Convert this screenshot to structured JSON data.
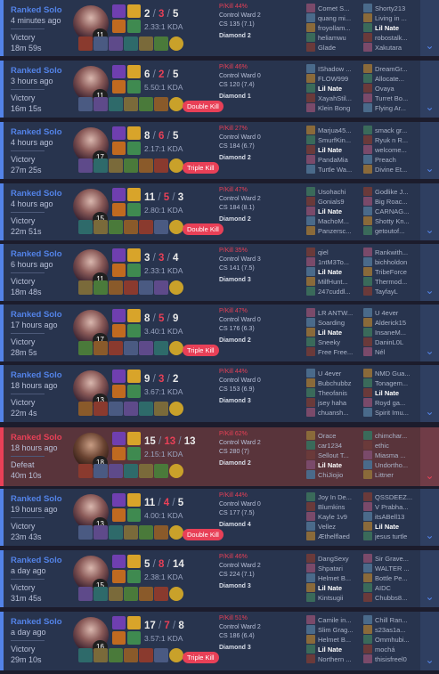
{
  "colors": {
    "victory_accent": "#5383e8",
    "defeat_accent": "#e84057",
    "victory_bg": "#28344e",
    "defeat_bg": "#59343b"
  },
  "icons": {
    "expand": "chevron-down-icon"
  },
  "matches": [
    {
      "type": "Ranked Solo",
      "ago": "4 minutes ago",
      "result": "Victory",
      "duration": "18m 59s",
      "win": true,
      "level": "11",
      "k": "2",
      "d": "3",
      "a": "5",
      "kda": "2.33:1 KDA",
      "multikill": "",
      "kp": "P/Kill 44%",
      "ward": "Control Ward 2",
      "cs": "CS 135 (7.1)",
      "rank": "Diamond 2",
      "blue": [
        "Comet S...",
        "quang mi...",
        "froyollam...",
        "heliamwu",
        "Glade"
      ],
      "red": [
        "Shorty213",
        "Living in ...",
        "Lil Nate",
        "robostalk...",
        "Xakutara"
      ]
    },
    {
      "type": "Ranked Solo",
      "ago": "3 hours ago",
      "result": "Victory",
      "duration": "16m 15s",
      "win": true,
      "level": "11",
      "k": "6",
      "d": "2",
      "a": "5",
      "kda": "5.50:1 KDA",
      "multikill": "Double Kill",
      "kp": "P/Kill 46%",
      "ward": "Control Ward 0",
      "cs": "CS 120 (7.4)",
      "rank": "Diamond 1",
      "blue": [
        "IShadow ...",
        "FLOW999",
        "Lil Nate",
        "XayahStil...",
        "Klein Bong"
      ],
      "red": [
        "DreamGr...",
        "Allocate...",
        "Ovaya",
        "Turret Bo...",
        "Flying Ar..."
      ]
    },
    {
      "type": "Ranked Solo",
      "ago": "4 hours ago",
      "result": "Victory",
      "duration": "27m 25s",
      "win": true,
      "level": "17",
      "k": "8",
      "d": "6",
      "a": "5",
      "kda": "2.17:1 KDA",
      "multikill": "Triple Kill",
      "kp": "P/Kill 27%",
      "ward": "Control Ward 0",
      "cs": "CS 184 (6.7)",
      "rank": "Diamond 2",
      "blue": [
        "Marjua45...",
        "SmurfKin...",
        "Lil Nate",
        "PandaMia",
        "Turtle Wa..."
      ],
      "red": [
        "smack gr...",
        "Ryuk n R...",
        "welcome...",
        "Preach",
        "Divine Et..."
      ]
    },
    {
      "type": "Ranked Solo",
      "ago": "4 hours ago",
      "result": "Victory",
      "duration": "22m 51s",
      "win": true,
      "level": "15",
      "k": "11",
      "d": "5",
      "a": "3",
      "kda": "2.80:1 KDA",
      "multikill": "Double Kill",
      "kp": "P/Kill 47%",
      "ward": "Control Ward 2",
      "cs": "CS 184 (8.1)",
      "rank": "Diamond 2",
      "blue": [
        "Usohachi",
        "Gonials9",
        "Lil Nate",
        "MachoM...",
        "Panzersc..."
      ],
      "red": [
        "Godlike J...",
        "Big Roac...",
        "CARNAG...",
        "Shotty Kn...",
        "getoutof..."
      ]
    },
    {
      "type": "Ranked Solo",
      "ago": "6 hours ago",
      "result": "Victory",
      "duration": "18m 48s",
      "win": true,
      "level": "11",
      "k": "3",
      "d": "3",
      "a": "4",
      "kda": "2.33:1 KDA",
      "multikill": "",
      "kp": "P/Kill 35%",
      "ward": "Control Ward 3",
      "cs": "CS 141 (7.5)",
      "rank": "Diamond 3",
      "blue": [
        "qiel",
        "1ntM3To...",
        "Lil Nate",
        "MilfHunt...",
        "247cuddl..."
      ],
      "red": [
        "Rankwith...",
        "bichholdon",
        "TribeForce",
        "Thermod...",
        "TayfayL"
      ]
    },
    {
      "type": "Ranked Solo",
      "ago": "17 hours ago",
      "result": "Victory",
      "duration": "28m 5s",
      "win": true,
      "level": "17",
      "k": "8",
      "d": "5",
      "a": "9",
      "kda": "3.40:1 KDA",
      "multikill": "Triple Kill",
      "kp": "P/Kill 47%",
      "ward": "Control Ward 0",
      "cs": "CS 176 (6.3)",
      "rank": "Diamond 2",
      "blue": [
        "LR ANTW...",
        "Soarding",
        "Lil Nate",
        "Sneeky",
        "Free Free..."
      ],
      "red": [
        "U 4ever",
        "Alderick15",
        "InsaneM...",
        "DaninL0L",
        "Nél"
      ]
    },
    {
      "type": "Ranked Solo",
      "ago": "18 hours ago",
      "result": "Victory",
      "duration": "22m 4s",
      "win": true,
      "level": "13",
      "k": "9",
      "d": "3",
      "a": "2",
      "kda": "3.67:1 KDA",
      "multikill": "",
      "kp": "P/Kill 44%",
      "ward": "Control Ward 0",
      "cs": "CS 153 (6.9)",
      "rank": "Diamond 3",
      "blue": [
        "U 4ever",
        "Bubchubbz",
        "Theofanis",
        "jsey haha",
        "chuansh..."
      ],
      "red": [
        "NMD Gua...",
        "Tonagem...",
        "Lil Nate",
        "Royd ga...",
        "Spirit Imu..."
      ]
    },
    {
      "type": "Ranked Solo",
      "ago": "18 hours ago",
      "result": "Defeat",
      "duration": "40m 10s",
      "win": false,
      "level": "18",
      "k": "15",
      "d": "13",
      "a": "13",
      "kda": "2.15:1 KDA",
      "multikill": "",
      "kp": "P/Kill 62%",
      "ward": "Control Ward 2",
      "cs": "CS 280 (7)",
      "rank": "Diamond 2",
      "blue": [
        "Orace",
        "car1234",
        "Sellout T...",
        "Lil Nate",
        "ChiJiojio"
      ],
      "red": [
        "chimchar...",
        "ethic",
        "Miasma ...",
        "Undortho...",
        "Littner"
      ]
    },
    {
      "type": "Ranked Solo",
      "ago": "19 hours ago",
      "result": "Victory",
      "duration": "23m 43s",
      "win": true,
      "level": "13",
      "k": "11",
      "d": "4",
      "a": "5",
      "kda": "4.00:1 KDA",
      "multikill": "Double Kill",
      "kp": "P/Kill 44%",
      "ward": "Control Ward 0",
      "cs": "CS 177 (7.5)",
      "rank": "Diamond 4",
      "blue": [
        "Joy In De...",
        "Blumkins",
        "Kayle 1v9",
        "Vellez",
        "Æthelflaed"
      ],
      "red": [
        "QSSDEEZ...",
        "V Prabha...",
        "itsABell13",
        "Lil Nate",
        "jesus turtle"
      ]
    },
    {
      "type": "Ranked Solo",
      "ago": "a day ago",
      "result": "Victory",
      "duration": "31m 45s",
      "win": true,
      "level": "15",
      "k": "5",
      "d": "8",
      "a": "14",
      "kda": "2.38:1 KDA",
      "multikill": "",
      "kp": "P/Kill 46%",
      "ward": "Control Ward 2",
      "cs": "CS 224 (7.1)",
      "rank": "Diamond 3",
      "blue": [
        "DangSexy",
        "Shpatari",
        "Helmet B...",
        "Lil Nate",
        "Kintsugii"
      ],
      "red": [
        "Sir Grave...",
        "WALTER ...",
        "Bottle Pe...",
        "AIDC",
        "Chubbs8..."
      ]
    },
    {
      "type": "Ranked Solo",
      "ago": "a day ago",
      "result": "Victory",
      "duration": "29m 10s",
      "win": true,
      "level": "16",
      "k": "17",
      "d": "7",
      "a": "8",
      "kda": "3.57:1 KDA",
      "multikill": "Triple Kill",
      "kp": "P/Kill 51%",
      "ward": "Control Ward 2",
      "cs": "CS 186 (6.4)",
      "rank": "Diamond 3",
      "blue": [
        "Camile in...",
        "Slim Grag...",
        "Helmet B...",
        "Lil Nate",
        "Northern ..."
      ],
      "red": [
        "Chill Ran...",
        "s23as1a...",
        "Ommhubi...",
        "mochá",
        "thisisfreel0"
      ]
    }
  ],
  "me": "Lil Nate"
}
